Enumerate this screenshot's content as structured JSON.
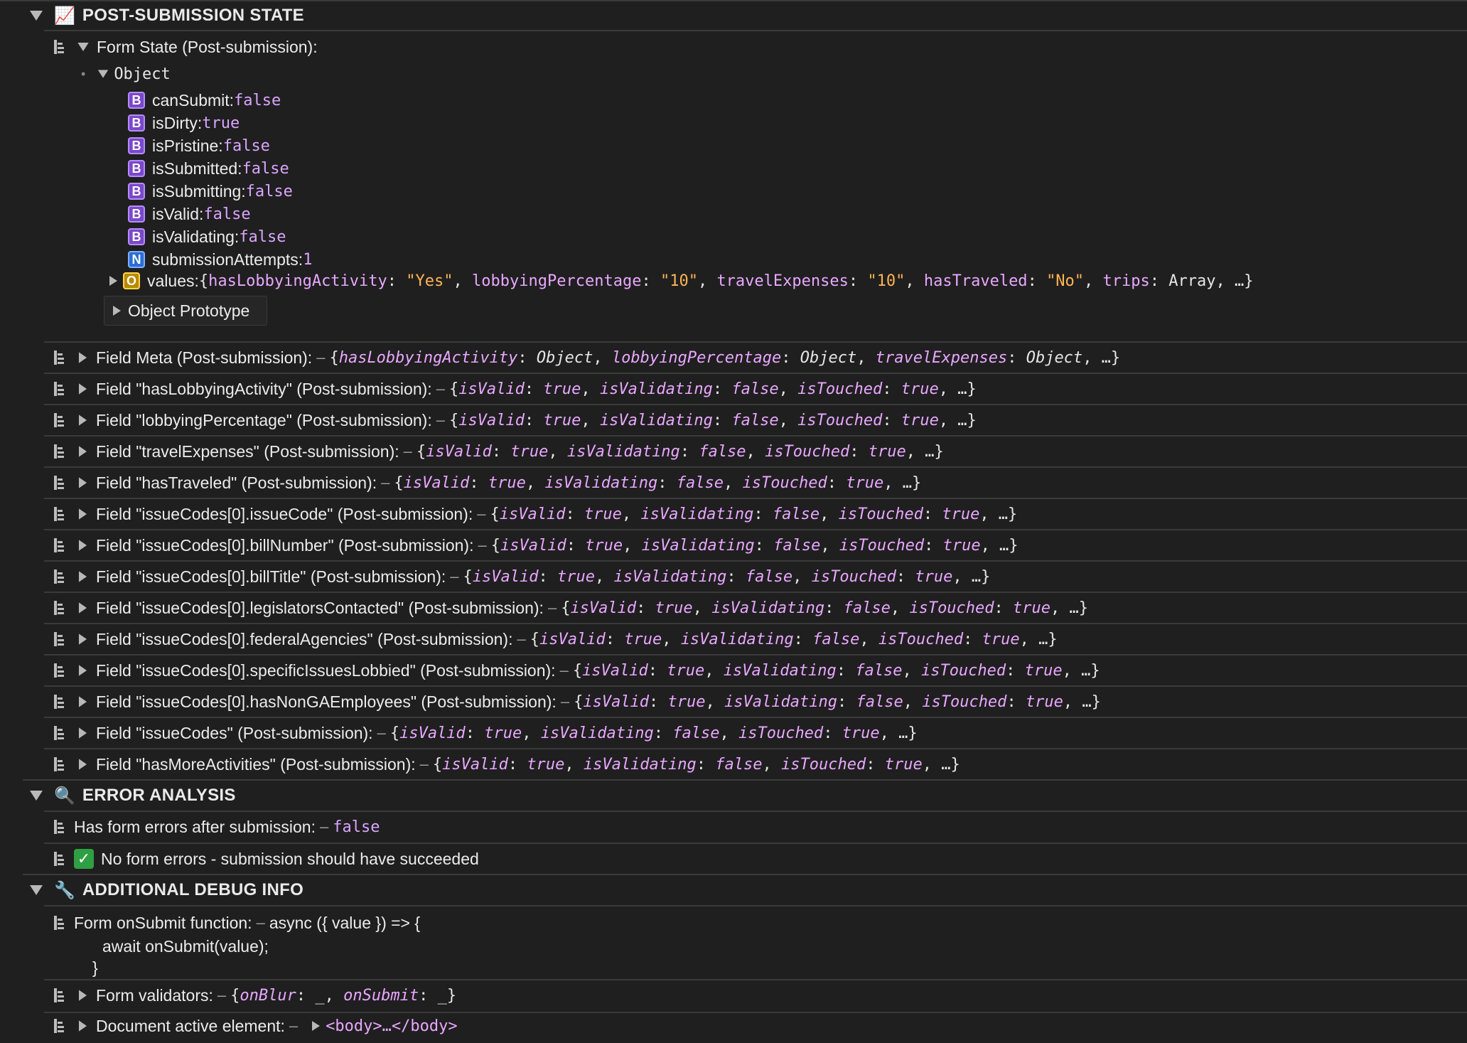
{
  "sections": {
    "post_submission": {
      "icon": "chart-increasing-emoji",
      "emoji": "📈",
      "title": "POST-SUBMISSION STATE"
    },
    "error_analysis": {
      "icon": "magnifier-emoji",
      "emoji": "🔍",
      "title": "ERROR ANALYSIS"
    },
    "debug": {
      "icon": "wrench-emoji",
      "emoji": "🔧",
      "title": "ADDITIONAL DEBUG INFO"
    }
  },
  "form_state": {
    "label": "Form State (Post-submission):",
    "object_label": "Object",
    "props": [
      {
        "badge": "B",
        "key": "canSubmit: ",
        "value": "false"
      },
      {
        "badge": "B",
        "key": "isDirty: ",
        "value": "true"
      },
      {
        "badge": "B",
        "key": "isPristine: ",
        "value": "false"
      },
      {
        "badge": "B",
        "key": "isSubmitted: ",
        "value": "false"
      },
      {
        "badge": "B",
        "key": "isSubmitting: ",
        "value": "false"
      },
      {
        "badge": "B",
        "key": "isValid: ",
        "value": "false"
      },
      {
        "badge": "B",
        "key": "isValidating: ",
        "value": "false"
      },
      {
        "badge": "N",
        "key": "submissionAttempts: ",
        "value": "1"
      }
    ],
    "values_row": {
      "badge": "O",
      "key": "values: ",
      "open": "{",
      "p1k": "hasLobbyingActivity",
      "p1v": "\"Yes\"",
      "p2k": "lobbyingPercentage",
      "p2v": "\"10\"",
      "p3k": "travelExpenses",
      "p3v": "\"10\"",
      "p4k": "hasTraveled",
      "p4v": "\"No\"",
      "p5k": "trips",
      "p5v": "Array",
      "tail": ", …}"
    },
    "prototype_label": "Object Prototype"
  },
  "field_meta": {
    "label": "Field Meta (Post-submission):",
    "k1": "hasLobbyingActivity",
    "k2": "lobbyingPercentage",
    "k3": "travelExpenses",
    "v": "Object"
  },
  "field_rows": [
    "Field \"hasLobbyingActivity\" (Post-submission):",
    "Field \"lobbyingPercentage\" (Post-submission):",
    "Field \"travelExpenses\" (Post-submission):",
    "Field \"hasTraveled\" (Post-submission):",
    "Field \"issueCodes[0].issueCode\" (Post-submission):",
    "Field \"issueCodes[0].billNumber\" (Post-submission):",
    "Field \"issueCodes[0].billTitle\" (Post-submission):",
    "Field \"issueCodes[0].legislatorsContacted\" (Post-submission):",
    "Field \"issueCodes[0].federalAgencies\" (Post-submission):",
    "Field \"issueCodes[0].specificIssuesLobbied\" (Post-submission):",
    "Field \"issueCodes[0].hasNonGAEmployees\" (Post-submission):",
    "Field \"issueCodes\" (Post-submission):",
    "Field \"hasMoreActivities\" (Post-submission):"
  ],
  "field_summary": {
    "k1": "isValid",
    "v1": "true",
    "k2": "isValidating",
    "v2": "false",
    "k3": "isTouched",
    "v3": "true"
  },
  "dash": "–",
  "error_analysis": {
    "has_errors_label": "Has form errors after submission:",
    "has_errors_value": "false",
    "no_errors_text": "No form errors - submission should have succeeded"
  },
  "debug": {
    "onsubmit_label": "Form onSubmit function:",
    "onsubmit_line1": "async ({ value }) => {",
    "onsubmit_line2": "await onSubmit(value);",
    "onsubmit_line3": "}",
    "validators_label": "Form validators:",
    "validators_k1": "onBlur",
    "validators_k2": "onSubmit",
    "validators_v": "_",
    "active_label": "Document active element:",
    "active_value": "<body>…</body>"
  }
}
